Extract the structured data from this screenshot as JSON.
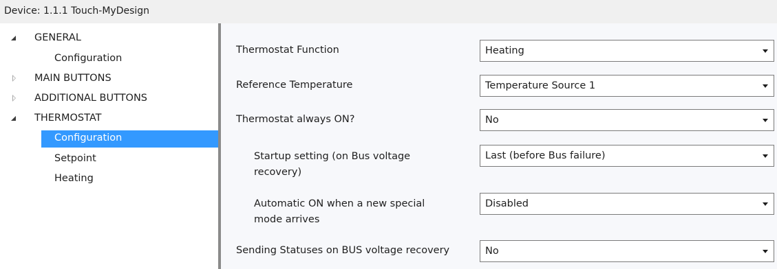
{
  "window": {
    "title": "Device: 1.1.1  Touch-MyDesign"
  },
  "tree": {
    "items": [
      {
        "label": "GENERAL",
        "state": "expanded"
      },
      {
        "label": "Configuration"
      },
      {
        "label": "MAIN BUTTONS",
        "state": "collapsed"
      },
      {
        "label": "ADDITIONAL BUTTONS",
        "state": "collapsed"
      },
      {
        "label": "THERMOSTAT",
        "state": "expanded"
      },
      {
        "label": "Configuration",
        "selected": true
      },
      {
        "label": "Setpoint"
      },
      {
        "label": "Heating"
      }
    ]
  },
  "params": [
    {
      "label": "Thermostat Function",
      "value": "Heating"
    },
    {
      "label": "Reference Temperature",
      "value": "Temperature Source 1"
    },
    {
      "label": "Thermostat always ON?",
      "value": "No"
    },
    {
      "label_line1": "Startup setting (on Bus voltage",
      "label_line2": "recovery)",
      "value": "Last (before Bus failure)"
    },
    {
      "label_line1": "Automatic ON when a new special",
      "label_line2": "mode arrives",
      "value": "Disabled"
    },
    {
      "label": "Sending Statuses on BUS voltage recovery",
      "value": "No"
    }
  ],
  "colors": {
    "selection": "#3399ff",
    "panel_bg": "#f7f8fb",
    "splitter": "#8a8a8a"
  }
}
